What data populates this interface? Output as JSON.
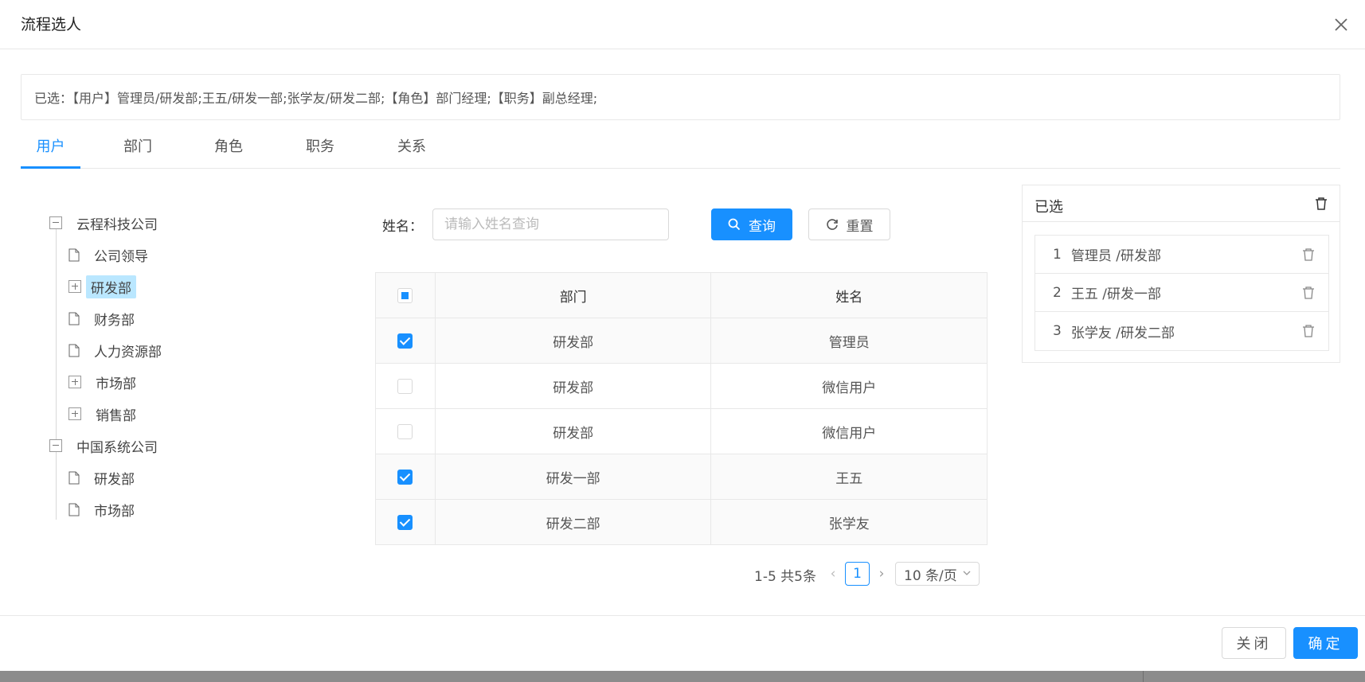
{
  "modal": {
    "title": "流程选人"
  },
  "selected_summary": "已选：【用户】管理员/研发部;王五/研发一部;张学友/研发二部;【角色】部门经理;【职务】副总经理;",
  "tabs": [
    {
      "label": "用户",
      "active": true
    },
    {
      "label": "部门",
      "active": false
    },
    {
      "label": "角色",
      "active": false
    },
    {
      "label": "职务",
      "active": false
    },
    {
      "label": "关系",
      "active": false
    }
  ],
  "tree": {
    "nodes": [
      {
        "label": "云程科技公司",
        "type": "folder-expanded",
        "level": 0
      },
      {
        "label": "公司领导",
        "type": "file",
        "level": 1
      },
      {
        "label": "研发部",
        "type": "folder-collapsed",
        "level": 1,
        "selected": true
      },
      {
        "label": "财务部",
        "type": "file",
        "level": 1
      },
      {
        "label": "人力资源部",
        "type": "file",
        "level": 1
      },
      {
        "label": "市场部",
        "type": "folder-collapsed",
        "level": 1
      },
      {
        "label": "销售部",
        "type": "folder-collapsed",
        "level": 1
      },
      {
        "label": "中国系统公司",
        "type": "folder-expanded",
        "level": 0
      },
      {
        "label": "研发部",
        "type": "file",
        "level": 1
      },
      {
        "label": "市场部",
        "type": "file",
        "level": 1
      }
    ]
  },
  "search": {
    "label": "姓名：",
    "placeholder": "请输入姓名查询",
    "value": "",
    "query_label": "查询",
    "reset_label": "重置"
  },
  "table": {
    "headers": [
      "部门",
      "姓名"
    ],
    "header_check_state": "indeterminate",
    "rows": [
      {
        "dept": "研发部",
        "name": "管理员",
        "checked": true
      },
      {
        "dept": "研发部",
        "name": "微信用户",
        "checked": false
      },
      {
        "dept": "研发部",
        "name": "微信用户",
        "checked": false
      },
      {
        "dept": "研发一部",
        "name": "王五",
        "checked": true
      },
      {
        "dept": "研发二部",
        "name": "张学友",
        "checked": true
      }
    ]
  },
  "pagination": {
    "total_text": "1-5 共5条",
    "current_page": "1",
    "page_size": "10 条/页"
  },
  "selected_panel": {
    "title": "已选",
    "items": [
      {
        "index": "1",
        "text": "管理员 /研发部"
      },
      {
        "index": "2",
        "text": "王五 /研发一部"
      },
      {
        "index": "3",
        "text": "张学友 /研发二部"
      }
    ]
  },
  "footer": {
    "close_label": "关闭",
    "confirm_label": "确定"
  },
  "colors": {
    "primary": "#1890ff",
    "tree_selected_bg": "#bae7ff",
    "border": "#e8e8e8"
  }
}
